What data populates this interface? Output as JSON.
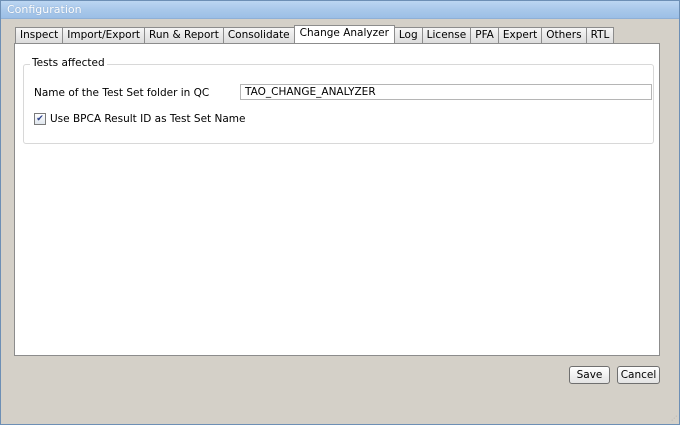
{
  "window": {
    "title": "Configuration"
  },
  "tabs": [
    {
      "label": "Inspect",
      "active": false
    },
    {
      "label": "Import/Export",
      "active": false
    },
    {
      "label": "Run & Report",
      "active": false
    },
    {
      "label": "Consolidate",
      "active": false
    },
    {
      "label": "Change Analyzer",
      "active": true
    },
    {
      "label": "Log",
      "active": false
    },
    {
      "label": "License",
      "active": false
    },
    {
      "label": "PFA",
      "active": false
    },
    {
      "label": "Expert",
      "active": false
    },
    {
      "label": "Others",
      "active": false
    },
    {
      "label": "RTL",
      "active": false
    }
  ],
  "tests_affected": {
    "group_title": "Tests affected",
    "folder_label": "Name of the Test Set folder in QC",
    "folder_value": "TAO_CHANGE_ANALYZER",
    "checkbox_label": "Use BPCA Result ID as Test Set Name",
    "checkbox_checked": true
  },
  "footer": {
    "save_label": "Save",
    "cancel_label": "Cancel"
  }
}
